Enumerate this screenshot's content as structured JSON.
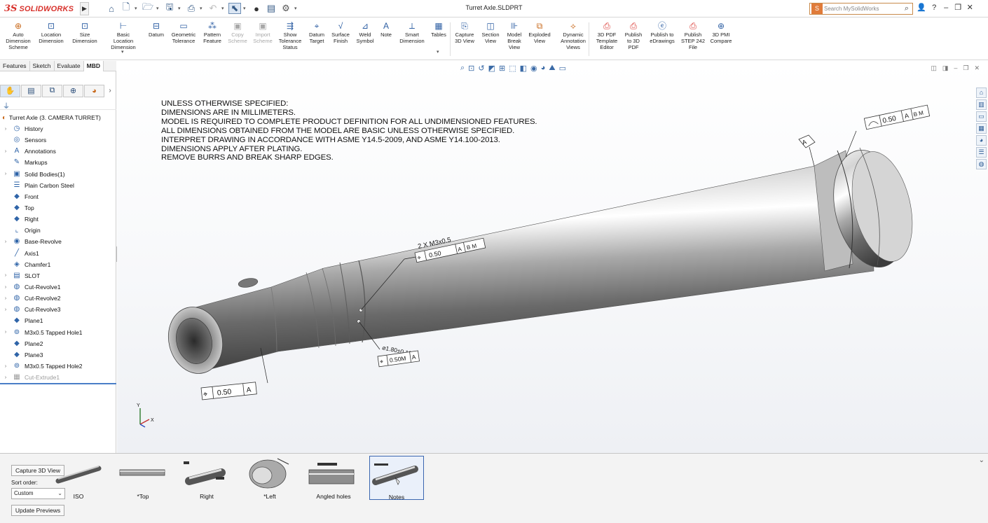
{
  "app": {
    "brand_ds": "3S",
    "brand_name": "SOLIDWORKS",
    "document_title": "Turret Axle.SLDPRT",
    "search_placeholder": "Search MySolidWorks",
    "help_icon": "?",
    "window_minimize": "–",
    "window_restore": "❐",
    "window_close": "✕"
  },
  "ribbon": {
    "buttons": [
      {
        "label": "Auto\nDimension\nScheme",
        "icon": "auto-dimension-icon",
        "disabled": false
      },
      {
        "label": "Location\nDimension",
        "icon": "location-dimension-icon",
        "disabled": false
      },
      {
        "label": "Size\nDimension",
        "icon": "size-dimension-icon",
        "disabled": false
      },
      {
        "label": "Basic Location\nDimension",
        "icon": "basic-location-dimension-icon",
        "disabled": false
      },
      {
        "label": "Datum",
        "icon": "datum-icon",
        "disabled": false
      },
      {
        "label": "Geometric\nTolerance",
        "icon": "geometric-tolerance-icon",
        "disabled": false
      },
      {
        "label": "Pattern\nFeature",
        "icon": "pattern-feature-icon",
        "disabled": false
      },
      {
        "label": "Copy\nScheme",
        "icon": "copy-scheme-icon",
        "disabled": true
      },
      {
        "label": "Import\nScheme",
        "icon": "import-scheme-icon",
        "disabled": true
      },
      {
        "label": "Show\nTolerance\nStatus",
        "icon": "tolerance-status-icon",
        "disabled": false
      },
      {
        "label": "Datum\nTarget",
        "icon": "datum-target-icon",
        "disabled": false
      },
      {
        "label": "Surface\nFinish",
        "icon": "surface-finish-icon",
        "disabled": false
      },
      {
        "label": "Weld\nSymbol",
        "icon": "weld-symbol-icon",
        "disabled": false
      },
      {
        "label": "Note",
        "icon": "note-icon",
        "disabled": false
      },
      {
        "label": "Smart\nDimension",
        "icon": "smart-dimension-icon",
        "disabled": false
      },
      {
        "label": "Tables",
        "icon": "tables-icon",
        "disabled": false
      },
      {
        "label": "Capture\n3D View",
        "icon": "capture-3d-view-icon",
        "disabled": false
      },
      {
        "label": "Section\nView",
        "icon": "section-view-icon",
        "disabled": false
      },
      {
        "label": "Model\nBreak\nView",
        "icon": "model-break-view-icon",
        "disabled": false
      },
      {
        "label": "Exploded\nView",
        "icon": "exploded-view-icon",
        "disabled": false
      },
      {
        "label": "Dynamic\nAnnotation\nViews",
        "icon": "dynamic-annotation-views-icon",
        "disabled": false
      },
      {
        "label": "3D PDF\nTemplate\nEditor",
        "icon": "3d-pdf-template-editor-icon",
        "disabled": false
      },
      {
        "label": "Publish\nto 3D\nPDF",
        "icon": "publish-3d-pdf-icon",
        "disabled": false
      },
      {
        "label": "Publish to\neDrawings",
        "icon": "publish-edrawings-icon",
        "disabled": false
      },
      {
        "label": "Publish\nSTEP 242\nFile",
        "icon": "publish-step-242-icon",
        "disabled": false
      },
      {
        "label": "3D PMI\nCompare",
        "icon": "3d-pmi-compare-icon",
        "disabled": false
      }
    ]
  },
  "manager_tabs": [
    {
      "label": "Features",
      "active": false
    },
    {
      "label": "Sketch",
      "active": false
    },
    {
      "label": "Evaluate",
      "active": false
    },
    {
      "label": "MBD",
      "active": true
    }
  ],
  "tree": {
    "root": "Turret Axle  (3. CAMERA TURRET)",
    "items": [
      {
        "label": "History",
        "icon": "history-icon",
        "expandable": true,
        "dim": false
      },
      {
        "label": "Sensors",
        "icon": "sensors-icon",
        "expandable": false,
        "dim": false
      },
      {
        "label": "Annotations",
        "icon": "annotations-icon",
        "expandable": true,
        "dim": false
      },
      {
        "label": "Markups",
        "icon": "markups-icon",
        "expandable": false,
        "dim": false
      },
      {
        "label": "Solid Bodies(1)",
        "icon": "solid-bodies-icon",
        "expandable": true,
        "dim": false
      },
      {
        "label": "Plain Carbon Steel",
        "icon": "material-icon",
        "expandable": false,
        "dim": false
      },
      {
        "label": "Front",
        "icon": "plane-icon",
        "expandable": false,
        "dim": false
      },
      {
        "label": "Top",
        "icon": "plane-icon",
        "expandable": false,
        "dim": false
      },
      {
        "label": "Right",
        "icon": "plane-icon",
        "expandable": false,
        "dim": false
      },
      {
        "label": "Origin",
        "icon": "origin-icon",
        "expandable": false,
        "dim": false
      },
      {
        "label": "Base-Revolve",
        "icon": "revolve-icon",
        "expandable": true,
        "dim": false
      },
      {
        "label": "Axis1",
        "icon": "axis-icon",
        "expandable": false,
        "dim": false
      },
      {
        "label": "Chamfer1",
        "icon": "chamfer-icon",
        "expandable": false,
        "dim": false
      },
      {
        "label": "SLOT",
        "icon": "folder-icon",
        "expandable": true,
        "dim": false
      },
      {
        "label": "Cut-Revolve1",
        "icon": "cut-revolve-icon",
        "expandable": true,
        "dim": false
      },
      {
        "label": "Cut-Revolve2",
        "icon": "cut-revolve-icon",
        "expandable": true,
        "dim": false
      },
      {
        "label": "Cut-Revolve3",
        "icon": "cut-revolve-icon",
        "expandable": true,
        "dim": false
      },
      {
        "label": "Plane1",
        "icon": "plane-icon",
        "expandable": false,
        "dim": false
      },
      {
        "label": "M3x0.5 Tapped Hole1",
        "icon": "hole-icon",
        "expandable": true,
        "dim": false
      },
      {
        "label": "Plane2",
        "icon": "plane-icon",
        "expandable": false,
        "dim": false
      },
      {
        "label": "Plane3",
        "icon": "plane-icon",
        "expandable": false,
        "dim": false
      },
      {
        "label": "M3x0.5 Tapped Hole2",
        "icon": "hole-icon",
        "expandable": true,
        "dim": false
      },
      {
        "label": "Cut-Extrude1",
        "icon": "extrude-icon",
        "expandable": true,
        "dim": true
      }
    ]
  },
  "notes": [
    "UNLESS OTHERWISE SPECIFIED:",
    "DIMENSIONS ARE IN MILLIMETERS.",
    "MODEL IS REQUIRED TO COMPLETE PRODUCT DEFINITION FOR ALL UNDIMENSIONED FEATURES.",
    "ALL DIMENSIONS OBTAINED FROM THE MODEL ARE BASIC UNLESS OTHERWISE SPECIFIED.",
    "INTERPRET DRAWING IN ACCORDANCE WITH ASME Y14.5-2009, AND ASME Y14.100-2013.",
    "DIMENSIONS APPLY AFTER PLATING.",
    "REMOVE BURRS AND BREAK SHARP EDGES."
  ],
  "pmi": {
    "datum_a": "A",
    "profile_value": "0.50",
    "profile_refs": [
      "A",
      "B M"
    ],
    "hole_callout": "2 X M3x0.5",
    "position_value": "0.50",
    "position_refs": [
      "A",
      "B M"
    ],
    "dia_callout": "⌀1.80±0.10",
    "pos2_value": "0.50M",
    "pos2_ref": "A",
    "pos3_value": "0.50",
    "pos3_ref": "A",
    "triad_y": "Y",
    "triad_x": "X"
  },
  "bottom": {
    "capture_label": "Capture 3D View",
    "sort_label": "Sort order:",
    "sort_value": "Custom",
    "update_label": "Update Previews",
    "views": [
      {
        "label": "ISO",
        "active": false
      },
      {
        "label": "*Top",
        "active": false
      },
      {
        "label": "Right",
        "active": false
      },
      {
        "label": "*Left",
        "active": false
      },
      {
        "label": "Angled holes",
        "active": false
      },
      {
        "label": "Notes",
        "active": true
      }
    ]
  },
  "colors": {
    "brand_red": "#d8322c",
    "accent_blue": "#2e5fa3",
    "selection_blue": "#3a66b0"
  }
}
